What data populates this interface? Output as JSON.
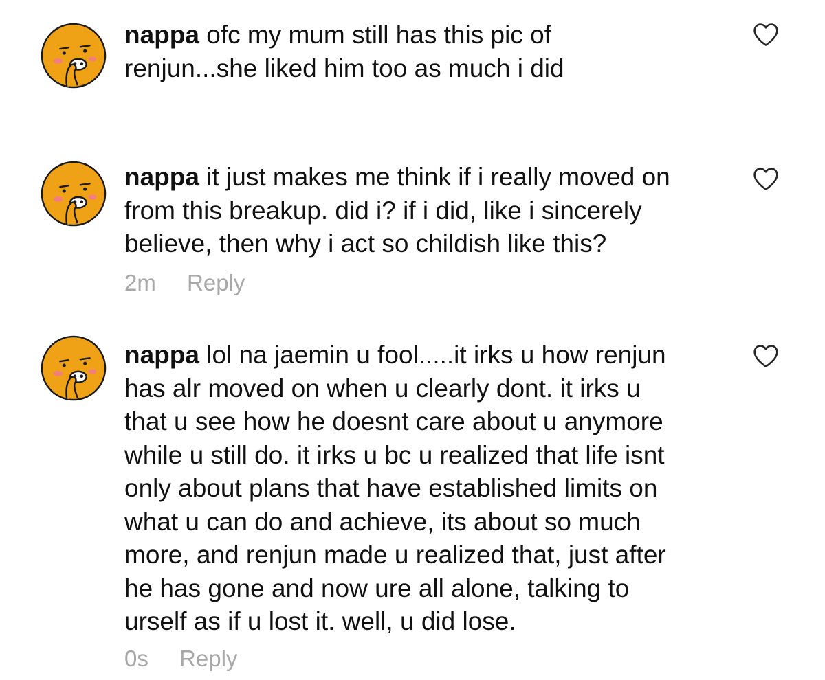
{
  "comments": [
    {
      "avatar_icon": "ryan-character-avatar",
      "username": "nappa",
      "lines": [
        " ofc my mum still has this pic of",
        "renjun...she liked him too as much i did"
      ],
      "like_icon": "heart-outline-icon"
    },
    {
      "avatar_icon": "ryan-character-avatar",
      "username": "nappa",
      "lines": [
        " it just makes me think if i really moved on",
        "from this breakup. did i? if i did, like i sincerely",
        "believe, then why i act so childish like this?"
      ],
      "like_icon": "heart-outline-icon",
      "timestamp": "2m",
      "reply_label": "Reply"
    },
    {
      "avatar_icon": "ryan-character-avatar",
      "username": "nappa",
      "lines": [
        " lol na jaemin u fool.....it irks u how renjun",
        "has alr moved on when u clearly dont. it irks u",
        "that u see how he doesnt care about u anymore",
        "while u still do. it irks u bc u realized that life isnt",
        "only about plans that have established limits on",
        "what u can do and achieve, its about so much",
        "more, and renjun made u realized that, just after",
        "he has gone and now ure all alone, talking to",
        "urself as if u lost it. well, u did lose."
      ],
      "like_icon": "heart-outline-icon",
      "timestamp": "0s",
      "reply_label": "Reply"
    }
  ],
  "colors": {
    "avatar_fill": "#f0a216",
    "avatar_stroke": "#1a1a1a",
    "blush": "#f47e7e",
    "meta_text": "#a8a8a8",
    "heart_stroke": "#262626"
  }
}
